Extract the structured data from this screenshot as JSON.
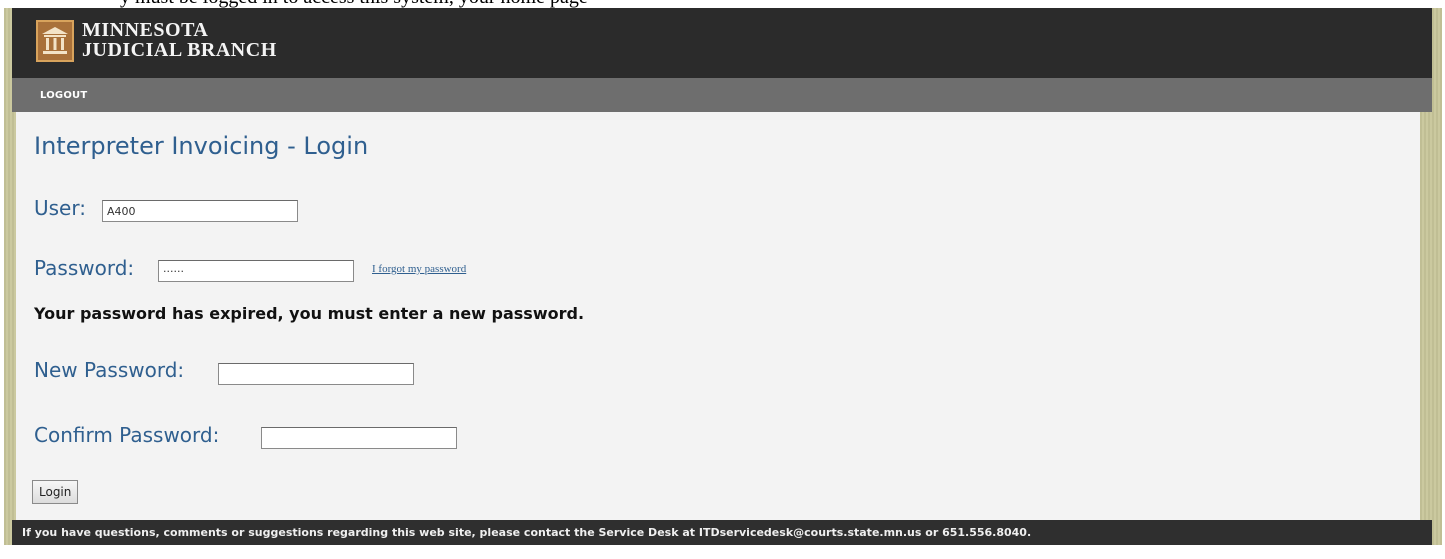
{
  "top_strip": {
    "text": "y must be logged in to access this system, your home page"
  },
  "header": {
    "logo_line1": "MINNESOTA",
    "logo_line2": "JUDICIAL BRANCH"
  },
  "nav": {
    "logout": "LOGOUT"
  },
  "form": {
    "title": "Interpreter Invoicing - Login",
    "user_label": "User:",
    "user_value": "A400",
    "password_label": "Password:",
    "password_value": "······",
    "forgot_link": "I forgot my password",
    "expired_message": "Your password has expired, you must enter a new password.",
    "new_password_label": "New Password:",
    "new_password_value": "",
    "confirm_password_label": "Confirm Password:",
    "confirm_password_value": "",
    "login_button": "Login"
  },
  "footer": {
    "text": "If you have questions, comments or suggestions regarding this web site, please contact the Service Desk at ITDservicedesk@courts.state.mn.us or 651.556.8040."
  },
  "colors": {
    "header_bg": "#2b2b2b",
    "nav_bg": "#6e6e6e",
    "frame_bg": "#c8c69a",
    "content_bg": "#f3f3f3",
    "label_blue": "#2f5f8f",
    "logo_badge": "#a9713a"
  }
}
